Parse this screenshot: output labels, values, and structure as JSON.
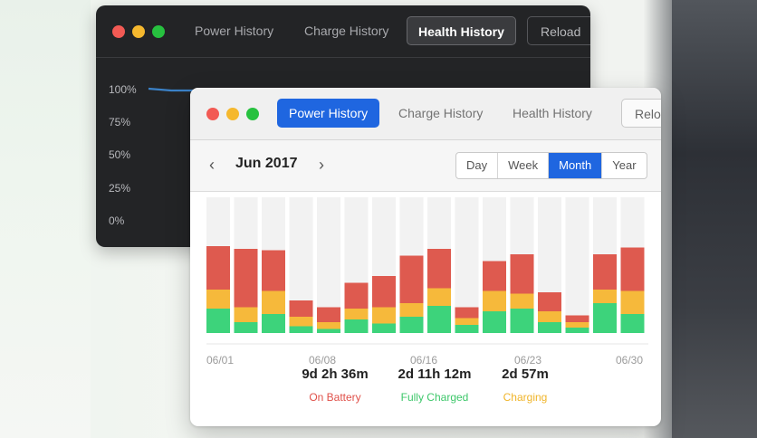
{
  "dark_window": {
    "tabs": [
      "Power History",
      "Charge History",
      "Health History"
    ],
    "active_tab": "Health History",
    "reload_label": "Reload",
    "y_axis": [
      "100%",
      "75%",
      "50%",
      "25%",
      "0%"
    ]
  },
  "light_window": {
    "tabs": [
      "Power History",
      "Charge History",
      "Health History"
    ],
    "active_tab": "Power History",
    "reload_label": "Relo",
    "nav": {
      "prev_icon": "‹",
      "next_icon": "›",
      "month": "Jun 2017"
    },
    "ranges": [
      "Day",
      "Week",
      "Month",
      "Year"
    ],
    "active_range": "Month",
    "stats": [
      {
        "value": "9d 2h 36m",
        "label": "On Battery",
        "color": "#e0514a"
      },
      {
        "value": "2d 11h 12m",
        "label": "Fully Charged",
        "color": "#3dc76a"
      },
      {
        "value": "2d 57m",
        "label": "Charging",
        "color": "#f0b429"
      }
    ]
  },
  "chart_data": {
    "type": "bar",
    "stacked": true,
    "x_ticks": [
      "06/01",
      "06/08",
      "06/16",
      "06/23",
      "06/30"
    ],
    "series": [
      {
        "name": "Fully Charged",
        "color": "#3dd37b",
        "values": [
          0.18,
          0.08,
          0.14,
          0.05,
          0.03,
          0.1,
          0.07,
          0.12,
          0.2,
          0.06,
          0.16,
          0.18,
          0.08,
          0.04,
          0.22,
          0.14
        ]
      },
      {
        "name": "Charging",
        "color": "#f6b93b",
        "values": [
          0.14,
          0.11,
          0.17,
          0.07,
          0.05,
          0.08,
          0.12,
          0.1,
          0.13,
          0.05,
          0.15,
          0.11,
          0.08,
          0.04,
          0.1,
          0.17
        ]
      },
      {
        "name": "On Battery",
        "color": "#de5a4f",
        "values": [
          0.32,
          0.43,
          0.3,
          0.12,
          0.11,
          0.19,
          0.23,
          0.35,
          0.29,
          0.08,
          0.22,
          0.29,
          0.14,
          0.05,
          0.26,
          0.32
        ]
      }
    ],
    "ylim": [
      0,
      1
    ],
    "grid": false,
    "legend": "below"
  },
  "health_series": [
    100,
    99,
    99
  ]
}
